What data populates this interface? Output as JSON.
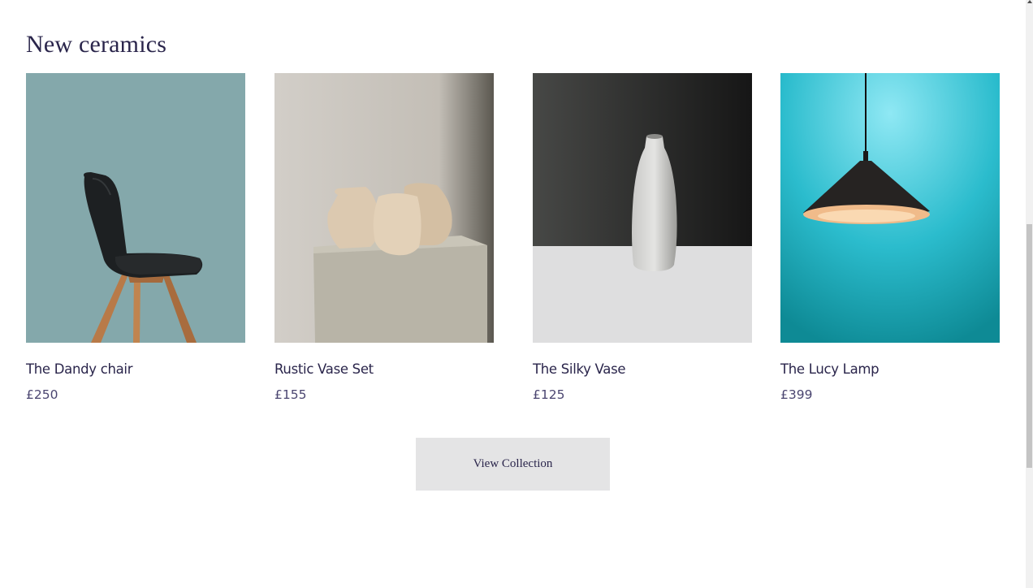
{
  "section": {
    "title": "New ceramics"
  },
  "products": [
    {
      "name": "The Dandy chair",
      "price": "£250",
      "image_bg": "#84a8ab"
    },
    {
      "name": "Rustic Vase Set",
      "price": "£155",
      "image_bg": "#cfcbc4"
    },
    {
      "name": "The Silky Vase",
      "price": "£125",
      "image_bg": "#3c3d3b"
    },
    {
      "name": "The Lucy Lamp",
      "price": "£399",
      "image_bg": "#2ab7c8"
    }
  ],
  "cta": {
    "label": "View Collection"
  },
  "colors": {
    "text": "#2a254b",
    "button_bg": "#e4e4e5"
  }
}
